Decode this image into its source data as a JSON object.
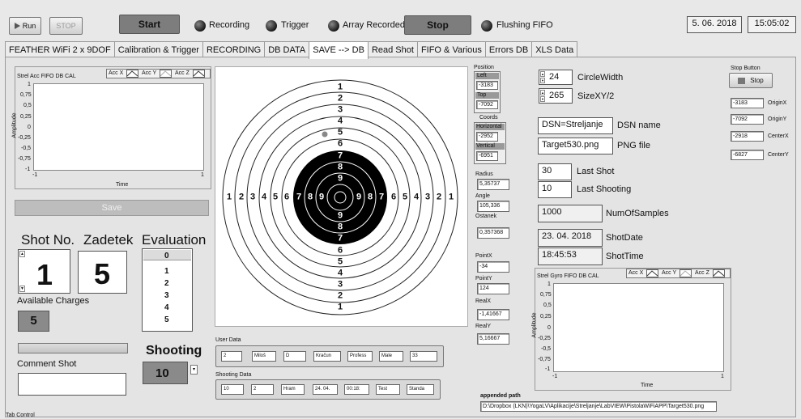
{
  "toolbar": {
    "run": "Run",
    "stop": "STOP",
    "start": "Start",
    "stop_dark": "Stop",
    "date": "5. 06. 2018",
    "time": "15:05:02"
  },
  "leds": [
    "Recording",
    "Trigger",
    "Array Recorded",
    "Flushing FIFO"
  ],
  "tabs": [
    "FEATHER WiFi 2 x 9DOF",
    "Calibration & Trigger",
    "RECORDING",
    "DB DATA",
    "SAVE --> DB",
    "Read Shot",
    "FIFO & Various",
    "Errors DB",
    "XLS Data"
  ],
  "chart1": {
    "title": "Strel Acc FIFO DB CAL",
    "legend": [
      "Acc X",
      "Acc Y",
      "Acc Z"
    ],
    "ylabel": "Amplitude",
    "xlabel": "Time",
    "yticks": [
      "1",
      "0,75",
      "0,5",
      "0,25",
      "0",
      "-0,25",
      "-0,5",
      "-0,75",
      "-1"
    ],
    "xmin": "-1",
    "xmax": "1"
  },
  "save_button": "Save",
  "shot": {
    "label_no": "Shot No.",
    "label_zadetek": "Zadetek",
    "label_eval": "Evaluation",
    "shot_no": "1",
    "zadetek": "5",
    "eval_list": [
      "0",
      "1",
      "2",
      "3",
      "4",
      "5"
    ],
    "available_label": "Available Charges",
    "available": "5"
  },
  "shooting": {
    "label": "Shooting",
    "value": "10"
  },
  "comment": {
    "label": "Comment Shot",
    "value": ""
  },
  "tab_control_label": "Tab Control",
  "target": {
    "ring_numbers": [
      "1",
      "2",
      "3",
      "4",
      "5",
      "6",
      "7",
      "8",
      "9",
      "9",
      "8",
      "7",
      "6",
      "5",
      "4",
      "3",
      "2",
      "1"
    ],
    "horizontal_numbers": [
      "1",
      "2",
      "3",
      "4",
      "5",
      "6",
      "7",
      "8",
      "9",
      "9",
      "8",
      "7",
      "6",
      "5",
      "4",
      "3",
      "2",
      "1"
    ]
  },
  "user_data": {
    "label": "User Data",
    "cells": [
      "2",
      "Miloš",
      "D",
      "Kračun",
      "Profess",
      "Male",
      "33"
    ]
  },
  "shooting_data": {
    "label": "Shooting Data",
    "cells": [
      "10",
      "2",
      "Hram",
      "24. 04.",
      "00:18:",
      "Test",
      "Standa"
    ]
  },
  "position": {
    "title": "Position",
    "left_label": "Left",
    "left": "-3183",
    "top_label": "Top",
    "top": "-7092",
    "coords_label": "Coords",
    "horizontal_label": "Horizontal",
    "horizontal": "-2952",
    "vertical_label": "Vertical",
    "vertical": "-6951"
  },
  "metrics": [
    {
      "label": "Radius",
      "value": "5,35737"
    },
    {
      "label": "Angle",
      "value": "105,336"
    },
    {
      "label": "Ostanek",
      "value": "0,357368"
    },
    {
      "label": "PointX",
      "value": "-34"
    },
    {
      "label": "PointY",
      "value": "124"
    },
    {
      "label": "RealX",
      "value": "-1,41667"
    },
    {
      "label": "RealY",
      "value": "5,16667"
    }
  ],
  "circle": {
    "width_label": "CircleWidth",
    "width": "24",
    "size_label": "SizeXY/2",
    "size": "265"
  },
  "dsn": {
    "value": "DSN=Streljanje",
    "label": "DSN name"
  },
  "png": {
    "value": "Target530.png",
    "label": "PNG file"
  },
  "last": {
    "shot": "30",
    "shot_label": "Last Shot",
    "shooting": "10",
    "shooting_label": "Last Shooting"
  },
  "samples": {
    "value": "1000",
    "label": "NumOfSamples"
  },
  "shotdate": {
    "value": "23. 04. 2018",
    "label": "ShotDate"
  },
  "shottime": {
    "value": "18:45:53",
    "label": "ShotTime"
  },
  "chart2": {
    "title": "Strel Gyro FIFO DB CAL",
    "legend": [
      "Acc X",
      "Acc Y",
      "Acc Z"
    ],
    "ylabel": "Amplitude",
    "xlabel": "Time",
    "yticks": [
      "1",
      "0,75",
      "0,5",
      "0,25",
      "0",
      "-0,25",
      "-0,5",
      "-0,75",
      "-1"
    ],
    "xmin": "-1",
    "xmax": "1"
  },
  "stop_button": {
    "label": "Stop Button",
    "text": "Stop"
  },
  "origins": [
    {
      "value": "-3183",
      "label": "OriginX"
    },
    {
      "value": "-7092",
      "label": "OriginY"
    },
    {
      "value": "-2918",
      "label": "CenterX"
    },
    {
      "value": "-6827",
      "label": "CenterY"
    }
  ],
  "path": {
    "label": "appended path",
    "value": "D:\\Dropbox (LKN)\\YogaLV\\Aplikacije\\Streljanje\\LabVIEW\\PistolaWiFiAPP\\Target530.png"
  },
  "colors": {
    "background": "#e8e8e8",
    "dark_button": "#7d7d7d",
    "bullseye": "#000000"
  }
}
